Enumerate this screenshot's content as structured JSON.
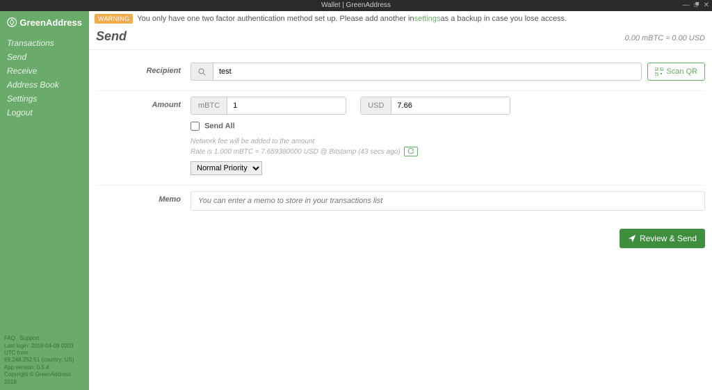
{
  "window": {
    "title": "Wallet | GreenAddress"
  },
  "sidebar": {
    "brand": "GreenAddress",
    "nav": [
      "Transactions",
      "Send",
      "Receive",
      "Address Book",
      "Settings",
      "Logout"
    ],
    "footer": {
      "links": [
        "FAQ",
        "Support"
      ],
      "line1": "Last login: 2018-04-09 0203 UTC from",
      "line2": "99.248.252.51 (country: US)",
      "line3": "App version: 0.5.4",
      "line4": "Copyright © GreenAddress 2018"
    }
  },
  "warning": {
    "badge": "WARNING",
    "text_before": "You only have one two factor authentication method set up. Please add another in ",
    "link": "settings",
    "text_after": " as a backup in case you lose access."
  },
  "page": {
    "title": "Send",
    "balance": "0.00 mBTC ≈ 0.00 USD"
  },
  "recipient": {
    "label": "Recipient",
    "value": "test",
    "scan": "Scan QR"
  },
  "amount": {
    "label": "Amount",
    "unit1": "mBTC",
    "value1": "1",
    "unit2": "USD",
    "value2": "7.66",
    "sendall": "Send All",
    "fee_note": "Network fee will be added to the amount",
    "rate_note": "Rate is 1.000 mBTC = 7.659380000 USD @ Bitstamp (43 secs ago)",
    "priority": "Normal Priority"
  },
  "memo": {
    "label": "Memo",
    "placeholder": "You can enter a memo to store in your transactions list"
  },
  "actions": {
    "review": "Review & Send"
  }
}
